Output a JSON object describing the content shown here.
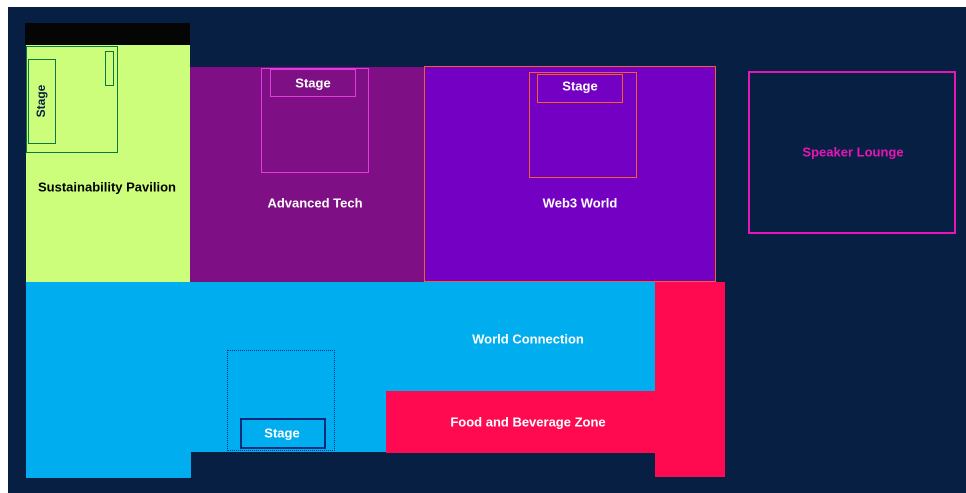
{
  "zones": {
    "sustainability": {
      "label": "Sustainability Pavilion",
      "color": "#ccfd7b"
    },
    "advanced_tech": {
      "label": "Advanced Tech",
      "color": "#7e0f84"
    },
    "web3": {
      "label": "Web3 World",
      "color": "#7400c3"
    },
    "speaker_lounge": {
      "label": "Speaker Lounge",
      "color": "#e815b7"
    },
    "world_connection": {
      "label": "World Connection",
      "color": "#00adef"
    },
    "food": {
      "label": "Food and Beverage Zone",
      "color": "#ff0a50"
    }
  },
  "stages": {
    "sustainability": "Stage",
    "advanced_tech": "Stage",
    "web3": "Stage",
    "world_connection": "Stage"
  },
  "colors": {
    "background": "#061f42",
    "black_bar": "#050505",
    "green_outline": "#0a7a3e",
    "magenta_outline": "#e23bdb",
    "orange_outline": "#f5602a",
    "navy_outline": "#0a2a7a"
  }
}
